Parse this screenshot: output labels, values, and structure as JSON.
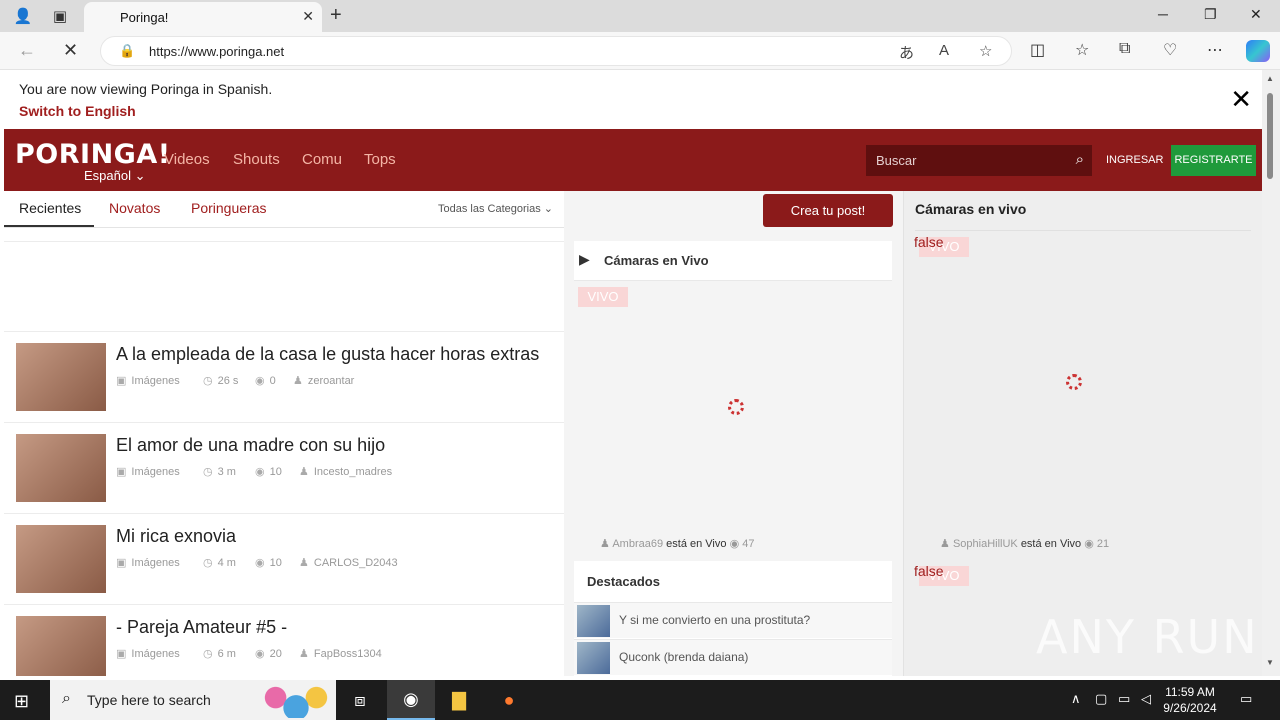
{
  "browser": {
    "tab_title": "Poringa!",
    "url": "https://www.poringa.net"
  },
  "notice": {
    "text": "You are now viewing Poringa in Spanish.",
    "link": "Switch to English"
  },
  "header": {
    "logo": "PORINGA!",
    "language": "Español",
    "nav": [
      "Videos",
      "Shouts",
      "Comu",
      "Tops"
    ],
    "search_placeholder": "Buscar",
    "login": "INGRESAR",
    "register": "REGISTRARTE"
  },
  "posts_tabs": {
    "tabs": [
      "Recientes",
      "Novatos",
      "Poringueras"
    ],
    "categories": "Todas las Categorias"
  },
  "posts": [
    {
      "title": "A la empleada de la casa le gusta hacer horas extras",
      "category": "Imágenes",
      "time": "26 s",
      "points": "0",
      "user": "zeroantar"
    },
    {
      "title": "El amor de una madre con su hijo",
      "category": "Imágenes",
      "time": "3 m",
      "points": "10",
      "user": "Incesto_madres"
    },
    {
      "title": "Mi rica exnovia",
      "category": "Imágenes",
      "time": "4 m",
      "points": "10",
      "user": "CARLOS_D2043"
    },
    {
      "title": "- Pareja Amateur #5 -",
      "category": "Imágenes",
      "time": "6 m",
      "points": "20",
      "user": "FapBoss1304"
    }
  ],
  "middle": {
    "create_post": "Crea tu post!",
    "cams_title": "Cámaras en Vivo",
    "vivo": "VIVO",
    "live_user": "Ambraa69",
    "live_status": "está en Vivo",
    "live_views": "47",
    "featured_title": "Destacados",
    "featured": [
      "Y si me convierto en una prostituta?",
      "Quconk (brenda daiana)"
    ]
  },
  "right": {
    "title": "Cámaras en vivo",
    "false_label": "false",
    "vivo": "VIVO",
    "live_user": "SophiaHillUK",
    "live_status": "está en Vivo",
    "live_views": "21"
  },
  "watermark": "ANY RUN",
  "taskbar": {
    "search_text": "Type here to search",
    "time": "11:59 AM",
    "date": "9/26/2024"
  }
}
